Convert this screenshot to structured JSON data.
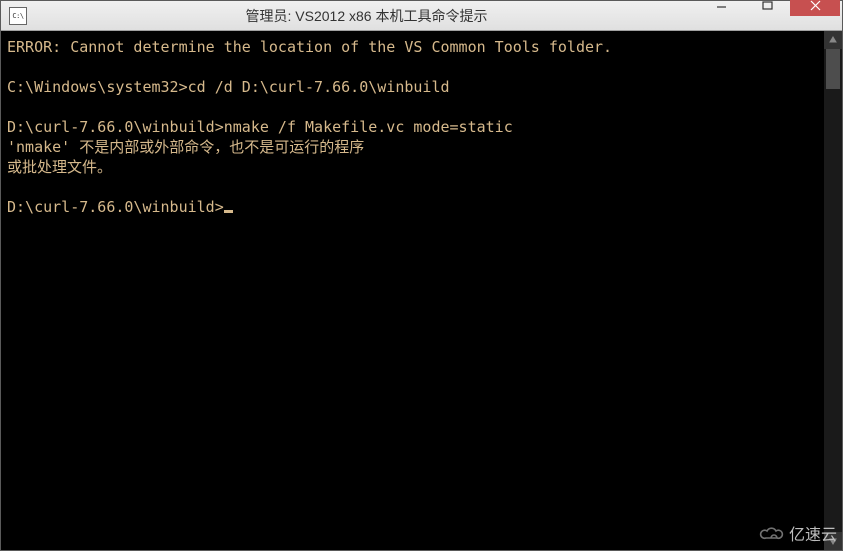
{
  "window": {
    "title": "管理员: VS2012 x86 本机工具命令提示",
    "icon_label": "C:\\"
  },
  "terminal": {
    "lines": [
      {
        "text": "ERROR: Cannot determine the location of the VS Common Tools folder.",
        "kind": "plain"
      },
      {
        "text": "",
        "kind": "blank"
      },
      {
        "prompt": "C:\\Windows\\system32>",
        "cmd": "cd /d D:\\curl-7.66.0\\winbuild",
        "kind": "cmd"
      },
      {
        "text": "",
        "kind": "blank"
      },
      {
        "prompt": "D:\\curl-7.66.0\\winbuild>",
        "cmd": "nmake /f Makefile.vc mode=static",
        "kind": "cmd"
      },
      {
        "text": "'nmake' 不是内部或外部命令，也不是可运行的程序",
        "kind": "plain"
      },
      {
        "text": "或批处理文件。",
        "kind": "plain"
      },
      {
        "text": "",
        "kind": "blank"
      },
      {
        "prompt": "D:\\curl-7.66.0\\winbuild>",
        "cmd": "",
        "kind": "cmd",
        "cursor": true
      }
    ]
  },
  "watermark": {
    "text": "亿速云"
  }
}
